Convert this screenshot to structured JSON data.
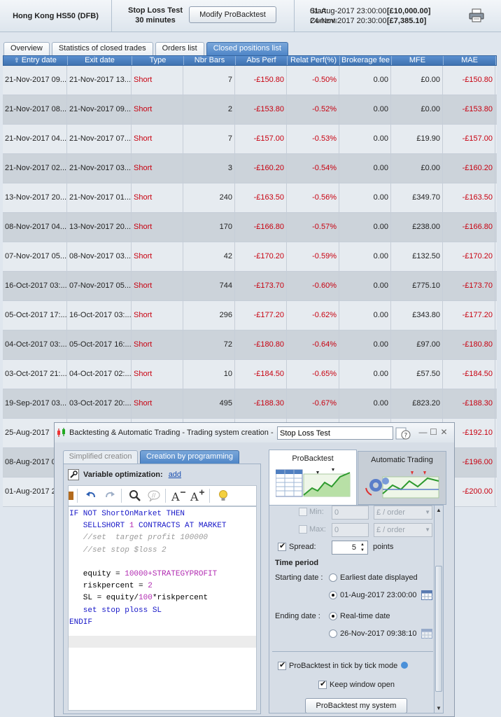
{
  "header": {
    "instrument": "Hong Kong HS50 (DFB)",
    "strategy_title": "Stop Loss Test",
    "timeframe": "30 minutes",
    "modify_button": "Modify ProBacktest",
    "start_label": "Start:",
    "start_date": "01-Aug-2017 23:00:00",
    "start_amount": "[£10,000.00]",
    "current_label": "Current:",
    "current_date": "24-Nov-2017 20:30:00",
    "current_amount": "[£7,385.10]",
    "print_icon": "printer-icon"
  },
  "tabs": [
    "Overview",
    "Statistics of closed trades",
    "Orders list",
    "Closed positions list"
  ],
  "active_tab": "Closed positions list",
  "table": {
    "columns": [
      "Entry date",
      "Exit date",
      "Type",
      "Nbr Bars",
      "Abs Perf",
      "Relat Perf(%)",
      "Brokerage fee",
      "MFE",
      "MAE"
    ],
    "sort_icon": "sort-up-arrow",
    "rows": [
      [
        "21-Nov-2017 09...",
        "21-Nov-2017 13...",
        "Short",
        "7",
        "-£150.80",
        "-0.50%",
        "0.00",
        "£0.00",
        "-£150.80"
      ],
      [
        "21-Nov-2017 08...",
        "21-Nov-2017 09...",
        "Short",
        "2",
        "-£153.80",
        "-0.52%",
        "0.00",
        "£0.00",
        "-£153.80"
      ],
      [
        "21-Nov-2017 04...",
        "21-Nov-2017 07...",
        "Short",
        "7",
        "-£157.00",
        "-0.53%",
        "0.00",
        "£19.90",
        "-£157.00"
      ],
      [
        "21-Nov-2017 02...",
        "21-Nov-2017 03...",
        "Short",
        "3",
        "-£160.20",
        "-0.54%",
        "0.00",
        "£0.00",
        "-£160.20"
      ],
      [
        "13-Nov-2017 20...",
        "21-Nov-2017 01...",
        "Short",
        "240",
        "-£163.50",
        "-0.56%",
        "0.00",
        "£349.70",
        "-£163.50"
      ],
      [
        "08-Nov-2017 04...",
        "13-Nov-2017 20...",
        "Short",
        "170",
        "-£166.80",
        "-0.57%",
        "0.00",
        "£238.00",
        "-£166.80"
      ],
      [
        "07-Nov-2017 05...",
        "08-Nov-2017 03...",
        "Short",
        "42",
        "-£170.20",
        "-0.59%",
        "0.00",
        "£132.50",
        "-£170.20"
      ],
      [
        "16-Oct-2017 03:...",
        "07-Nov-2017 05...",
        "Short",
        "744",
        "-£173.70",
        "-0.60%",
        "0.00",
        "£775.10",
        "-£173.70"
      ],
      [
        "05-Oct-2017 17:...",
        "16-Oct-2017 03:...",
        "Short",
        "296",
        "-£177.20",
        "-0.62%",
        "0.00",
        "£343.80",
        "-£177.20"
      ],
      [
        "04-Oct-2017 03:...",
        "05-Oct-2017 16:...",
        "Short",
        "72",
        "-£180.80",
        "-0.64%",
        "0.00",
        "£97.00",
        "-£180.80"
      ],
      [
        "03-Oct-2017 21:...",
        "04-Oct-2017 02:...",
        "Short",
        "10",
        "-£184.50",
        "-0.65%",
        "0.00",
        "£57.50",
        "-£184.50"
      ],
      [
        "19-Sep-2017 03...",
        "03-Oct-2017 20:...",
        "Short",
        "495",
        "-£188.30",
        "-0.67%",
        "0.00",
        "£823.20",
        "-£188.30"
      ],
      [
        "25-Aug-2017",
        "",
        "",
        "",
        "",
        "",
        "",
        "",
        "-£192.10"
      ],
      [
        "08-Aug-2017 0",
        "",
        "",
        "",
        "",
        "",
        "",
        "",
        "-£196.00"
      ],
      [
        "01-Aug-2017 2",
        "",
        "",
        "",
        "",
        "",
        "",
        "",
        "-£200.00"
      ]
    ]
  },
  "dialog": {
    "title": "Backtesting & Automatic Trading - Trading system creation  -",
    "name_value": "Stop Loss Test",
    "window_controls": [
      "—",
      "☐",
      "✕"
    ],
    "tabs": {
      "simplified": "Simplified creation",
      "programming": "Creation by programming"
    },
    "variable_optimization_label": "Variable optimization:",
    "variable_optimization_link": "add",
    "code": [
      [
        {
          "t": "IF NOT ShortOnMarket THEN",
          "c": "kw"
        }
      ],
      [
        {
          "t": "   SELLSHORT ",
          "c": "kw"
        },
        {
          "t": "1",
          "c": "nm"
        },
        {
          "t": " CONTRACTS AT MARKET",
          "c": "kw"
        }
      ],
      [
        {
          "t": "   //set  target profit 100000",
          "c": "cm"
        }
      ],
      [
        {
          "t": "   //set stop $loss 2",
          "c": "cm"
        }
      ],
      [
        {
          "t": "",
          "c": "plain"
        }
      ],
      [
        {
          "t": "   equity = ",
          "c": "plain"
        },
        {
          "t": "10000",
          "c": "nm"
        },
        {
          "t": "+STRATEGYPROFIT",
          "c": "nm"
        }
      ],
      [
        {
          "t": "   riskpercent = ",
          "c": "plain"
        },
        {
          "t": "2",
          "c": "nm"
        }
      ],
      [
        {
          "t": "   SL = equity/",
          "c": "plain"
        },
        {
          "t": "100",
          "c": "nm"
        },
        {
          "t": "*riskpercent",
          "c": "plain"
        }
      ],
      [
        {
          "t": "   set stop ploss SL",
          "c": "kw"
        }
      ],
      [
        {
          "t": "ENDIF",
          "c": "kw"
        }
      ]
    ],
    "modes": {
      "probacktest": "ProBacktest",
      "automatic": "Automatic Trading"
    },
    "settings": {
      "min_label": "Min:",
      "min_value": "0",
      "min_unit": "£ / order",
      "max_label": "Max:",
      "max_value": "0",
      "max_unit": "£ / order",
      "spread_label": "Spread:",
      "spread_value": "5",
      "spread_unit": "points",
      "time_period_title": "Time period",
      "starting_label": "Starting date :",
      "earliest_option": "Earliest date displayed",
      "start_date_option": "01-Aug-2017 23:00:00",
      "ending_label": "Ending date :",
      "realtime_option": "Real-time date",
      "end_date_option": "26-Nov-2017 09:38:10",
      "tick_mode_label": "ProBacktest in tick by tick mode",
      "keep_open_label": "Keep window open",
      "run_button": "ProBacktest my system"
    }
  }
}
